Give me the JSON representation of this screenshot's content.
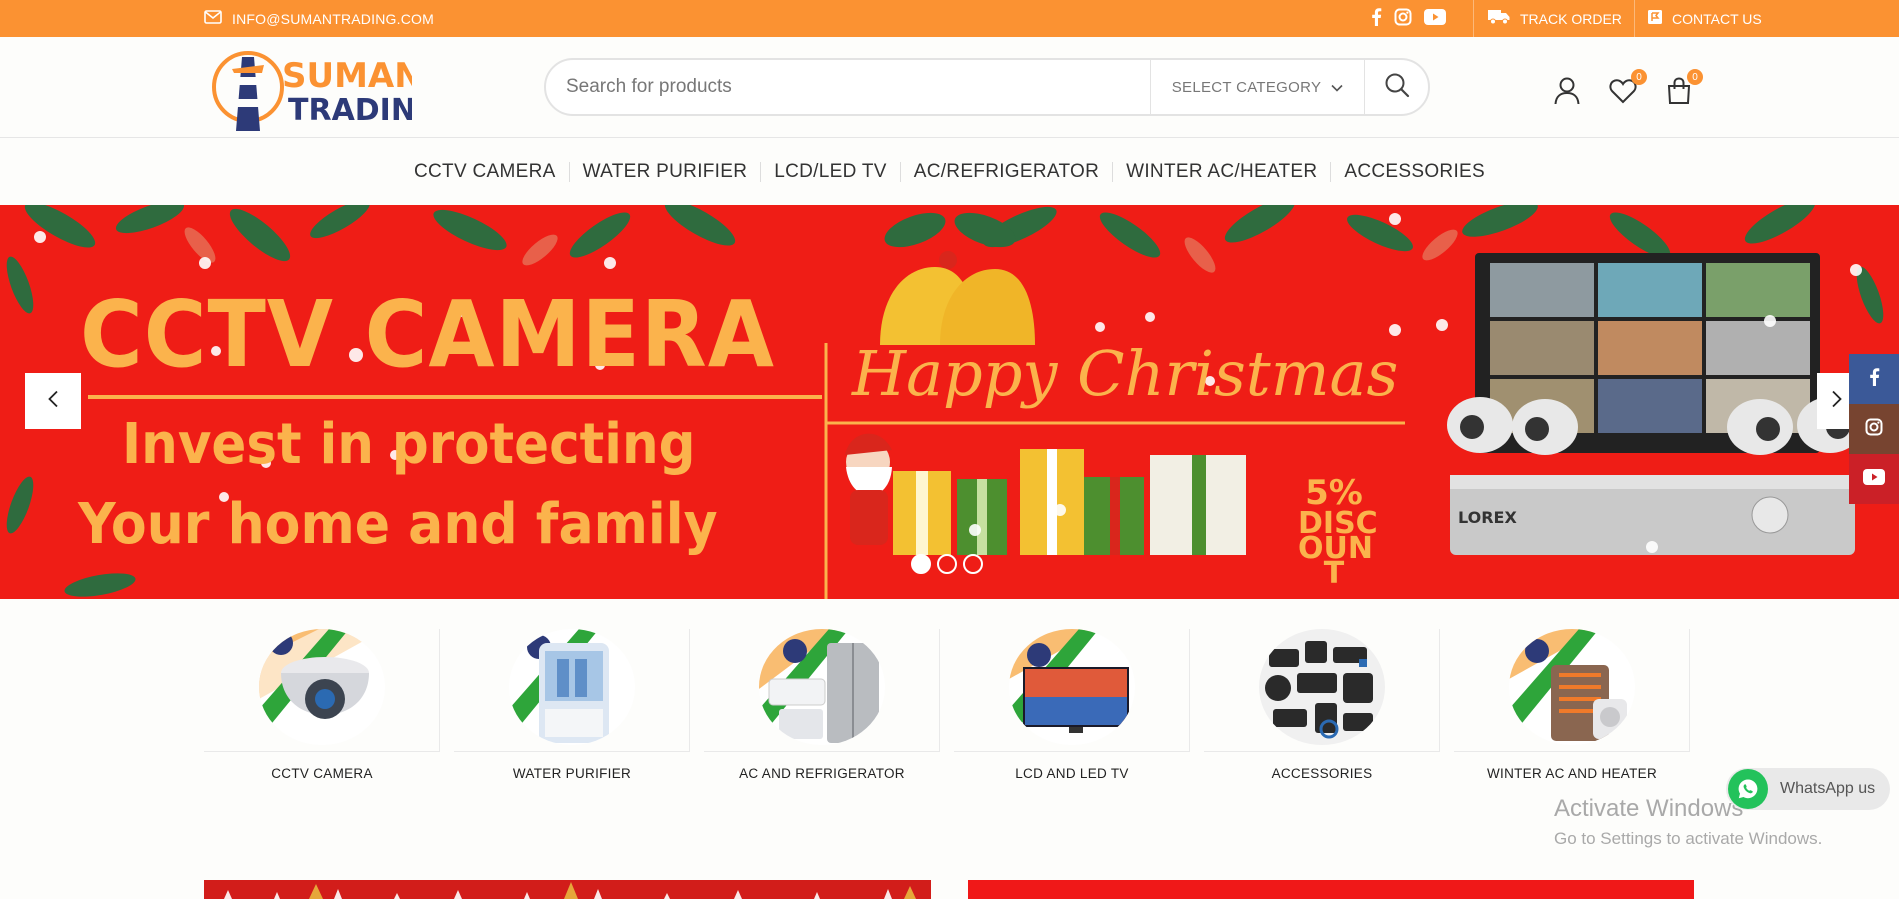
{
  "topbar": {
    "email": "INFO@SUMANTRADING.COM",
    "social": [
      "facebook-icon",
      "instagram-icon",
      "youtube-icon"
    ],
    "track_order": "TRACK ORDER",
    "contact_us": "CONTACT US",
    "bg_color": "#fb9232"
  },
  "logo": {
    "line1": "SUMAN",
    "line2": "TRADING"
  },
  "search": {
    "placeholder": "Search for products",
    "category_label": "SELECT CATEGORY"
  },
  "header_icons": {
    "wishlist_count": "0",
    "cart_count": "0"
  },
  "nav": {
    "items": [
      "CCTV CAMERA",
      "WATER PURIFIER",
      "LCD/LED TV",
      "AC/REFRIGERATOR",
      "WINTER AC/HEATER",
      "ACCESSORIES"
    ]
  },
  "hero": {
    "title": "CCTV CAMERA",
    "line2": "Invest in protecting",
    "line3": "Your home and family",
    "greeting": "Happy Christmas",
    "discount_pct": "5%",
    "discount_l1": "DISC",
    "discount_l2": "OUN",
    "discount_l3": "T",
    "brand": "LOREX",
    "active_slide": 1,
    "slide_count": 3
  },
  "categories": [
    {
      "label": "CCTV CAMERA"
    },
    {
      "label": "WATER PURIFIER"
    },
    {
      "label": "AC AND REFRIGERATOR"
    },
    {
      "label": "LCD AND LED TV"
    },
    {
      "label": "ACCESSORIES"
    },
    {
      "label": "WINTER AC AND HEATER"
    }
  ],
  "whatsapp": {
    "label": "WhatsApp us"
  },
  "watermark": {
    "title": "Activate Windows",
    "subtitle": "Go to Settings to activate Windows."
  }
}
